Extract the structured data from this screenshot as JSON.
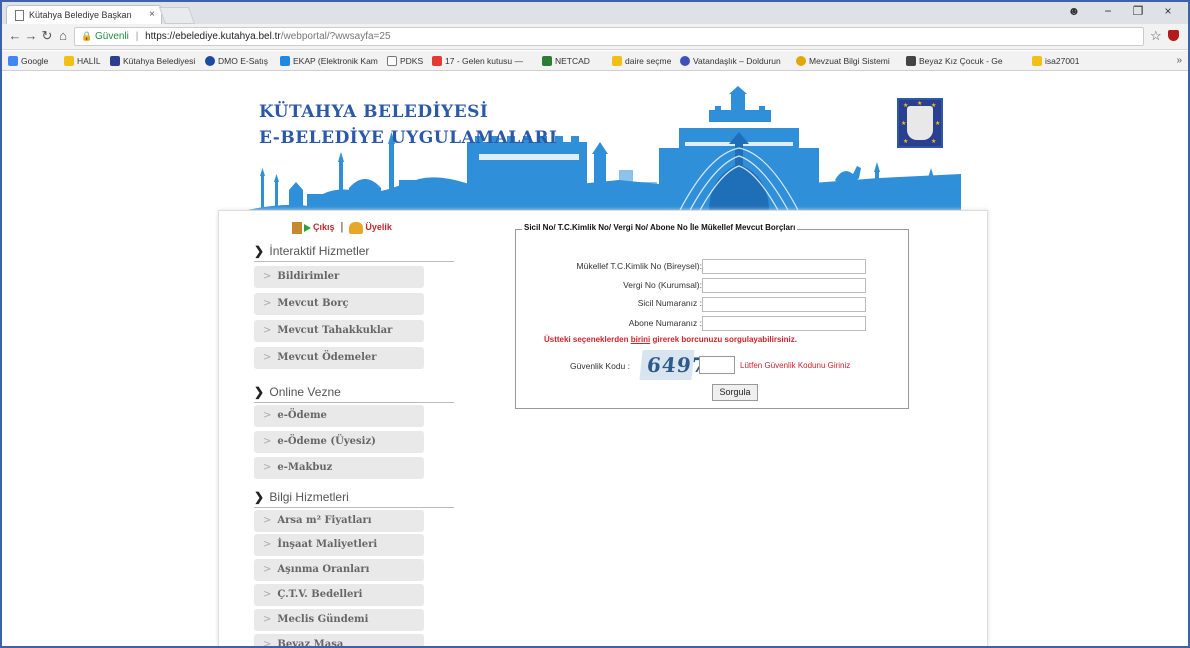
{
  "browser": {
    "tab_title": "Kütahya Belediye Başkan",
    "tab_close": "×",
    "window_controls": [
      "−",
      "❐",
      "×"
    ],
    "secure_label": "Güvenli",
    "url_host": "https://ebelediye.kutahya.bel.tr",
    "url_path": "/webportal/?wwsayfa=25",
    "bookmarks": [
      {
        "label": "Google",
        "color": "#4285f4"
      },
      {
        "label": "HALİL",
        "color": "#f2c012"
      },
      {
        "label": "Kütahya Belediyesi",
        "color": "#2c3f8f"
      },
      {
        "label": "DMO E-Satış",
        "color": "#1b4aa0"
      },
      {
        "label": "EKAP (Elektronik Kam",
        "color": "#1e88e5"
      },
      {
        "label": "PDKS",
        "color": "#777777"
      },
      {
        "label": "17 - Gelen kutusu —",
        "color": "#e53935"
      },
      {
        "label": "NETCAD",
        "color": "#2e7d32"
      },
      {
        "label": "daire seçme",
        "color": "#f2c012"
      },
      {
        "label": "Vatandaşlık – Doldurun",
        "color": "#3f51b5"
      },
      {
        "label": "Mevzuat Bilgi Sistemi",
        "color": "#e0a800"
      },
      {
        "label": "Beyaz Kız Çocuk - Ge",
        "color": "#444444"
      },
      {
        "label": "isa27001",
        "color": "#f2c012"
      }
    ],
    "bookmarks_more": "»"
  },
  "header": {
    "title_line1": "KÜTAHYA BELEDİYESİ",
    "title_line2": "E-BELEDİYE UYGULAMALARI",
    "banner_color": "#2f8fd8"
  },
  "userbar": {
    "logout": "Çıkış",
    "divider": "|",
    "membership": "Üyelik"
  },
  "sidebar": {
    "sections": [
      {
        "title": "İnteraktif Hizmetler",
        "items": [
          "Bildirimler",
          "Mevcut Borç",
          "Mevcut Tahakkuklar",
          "Mevcut Ödemeler"
        ]
      },
      {
        "title": "Online Vezne",
        "items": [
          "e-Ödeme",
          "e-Ödeme (Üyesiz)",
          "e-Makbuz"
        ]
      },
      {
        "title": "Bilgi Hizmetleri",
        "items": [
          "Arsa m² Fiyatları",
          "İnşaat Maliyetleri",
          "Aşınma Oranları",
          "Ç.T.V. Bedelleri",
          "Meclis Gündemi",
          "Beyaz Masa"
        ]
      }
    ]
  },
  "form": {
    "legend": "Sicil No/ T.C.Kimlik No/ Vergi No/ Abone No İle Mükellef Mevcut Borçları",
    "fields": [
      {
        "label": "Mükellef T.C.Kimlik No (Bireysel):",
        "value": ""
      },
      {
        "label": "Vergi No (Kurumsal):",
        "value": ""
      },
      {
        "label": "Sicil Numaranız :",
        "value": ""
      },
      {
        "label": "Abone Numaranız :",
        "value": ""
      }
    ],
    "warning_pre": "Üstteki seçeneklerden ",
    "warning_link": "birini",
    "warning_post": " girerek borcunuzu sorgulayabilirsiniz.",
    "captcha_label": "Güvenlik Kodu :",
    "captcha_text": "6497",
    "captcha_hint": "Lütfen Güvenlik Kodunu Giriniz",
    "submit": "Sorgula"
  }
}
